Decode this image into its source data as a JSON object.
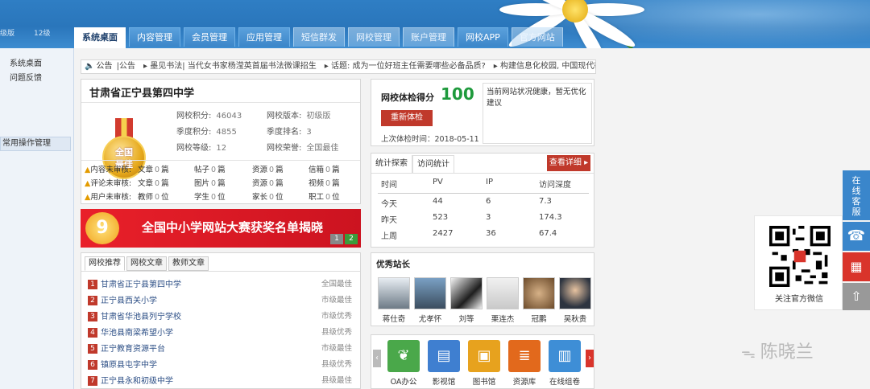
{
  "header": {
    "level_left": "级版",
    "level_right": "12级",
    "tabs": [
      "系统桌面",
      "内容管理",
      "会员管理",
      "应用管理",
      "短信群发",
      "网校管理",
      "账户管理",
      "网校APP",
      "官方网站"
    ]
  },
  "sidebar": {
    "items": [
      "系统桌面",
      "问题反馈"
    ],
    "group": "常用操作管理"
  },
  "notice": {
    "label": "公告",
    "text": "|公告　▸ 墨见书法| 当代女书家杨滢英首届书法微课招生　▸ 话题: 成为一位好班主任需要哪些必备品质?　▸ 构建信息化校园, 中国现代教"
  },
  "school": {
    "name": "甘肃省正宁县第四中学",
    "medal_text": "全国\n最佳",
    "stats": [
      {
        "label": "网校积分:",
        "value": "46043"
      },
      {
        "label": "网校版本:",
        "value": "初级版"
      },
      {
        "label": "季度积分:",
        "value": "4855"
      },
      {
        "label": "季度排名:",
        "value": "3"
      },
      {
        "label": "网校等级:",
        "value": "12"
      },
      {
        "label": "网校荣誉:",
        "value": "全国最佳"
      }
    ],
    "audit_rows": [
      {
        "label": "内容未审核:",
        "cells": [
          [
            "文章",
            "0",
            "篇"
          ],
          [
            "帖子",
            "0",
            "篇"
          ],
          [
            "资源",
            "0",
            "篇"
          ],
          [
            "信箱",
            "0",
            "篇"
          ]
        ]
      },
      {
        "label": "评论未审核:",
        "cells": [
          [
            "文章",
            "0",
            "篇"
          ],
          [
            "图片",
            "0",
            "篇"
          ],
          [
            "资源",
            "0",
            "篇"
          ],
          [
            "视频",
            "0",
            "篇"
          ]
        ]
      },
      {
        "label": "用户未审核:",
        "cells": [
          [
            "教师",
            "0",
            "位"
          ],
          [
            "学生",
            "0",
            "位"
          ],
          [
            "家长",
            "0",
            "位"
          ],
          [
            "职工",
            "0",
            "位"
          ]
        ]
      }
    ]
  },
  "banner": {
    "badge": "9",
    "text": "全国中小学网站大赛获奖名单揭晓",
    "pages": [
      "1",
      "2"
    ]
  },
  "recommend": {
    "tabs": [
      "网校推荐",
      "网校文章",
      "教师文章"
    ],
    "rows": [
      {
        "num": "1",
        "name": "甘肃省正宁县第四中学",
        "tag": "全国最佳"
      },
      {
        "num": "2",
        "name": "正宁县西关小学",
        "tag": "市级最佳"
      },
      {
        "num": "3",
        "name": "甘肃省华池县列宁学校",
        "tag": "市级优秀"
      },
      {
        "num": "4",
        "name": "华池县南梁希望小学",
        "tag": "县级优秀"
      },
      {
        "num": "5",
        "name": "正宁教育资源平台",
        "tag": "市级最佳"
      },
      {
        "num": "6",
        "name": "镇原县屯字中学",
        "tag": "县级优秀"
      },
      {
        "num": "7",
        "name": "正宁县永和初级中学",
        "tag": "县级最佳"
      }
    ]
  },
  "score": {
    "title": "网校体检得分",
    "value": "100",
    "recheck": "重新体检",
    "last_check": "上次体检时间：2018-05-11",
    "note": "当前网站状况健康，暂无优化建议"
  },
  "stats": {
    "tabs": [
      "统计探索",
      "访问统计"
    ],
    "view_detail": "查看详细 ▸",
    "header": [
      "时间",
      "PV",
      "IP",
      "访问深度"
    ],
    "rows": [
      [
        "今天",
        "44",
        "6",
        "7.3"
      ],
      [
        "昨天",
        "523",
        "3",
        "174.3"
      ],
      [
        "上周",
        "2427",
        "36",
        "67.4"
      ]
    ]
  },
  "principals": {
    "title": "优秀站长",
    "names": [
      "蒋仕奇",
      "尤孝怀",
      "刘等",
      "栗连杰",
      "冠鹏",
      "吴秋贵"
    ]
  },
  "apps": {
    "items": [
      {
        "label": "OA办公",
        "icon": "leaf-icon",
        "color": "#4aa84a"
      },
      {
        "label": "影视馆",
        "icon": "film-icon",
        "color": "#3f7fd0"
      },
      {
        "label": "图书馆",
        "icon": "book-icon",
        "color": "#e7a21e"
      },
      {
        "label": "资源库",
        "icon": "database-icon",
        "color": "#e2691c"
      },
      {
        "label": "在线组卷",
        "icon": "document-icon",
        "color": "#3e8ed6"
      }
    ]
  },
  "right": {
    "qr_label": "关注官方微信",
    "service": "在线客服",
    "watermark": "陈晓兰"
  }
}
